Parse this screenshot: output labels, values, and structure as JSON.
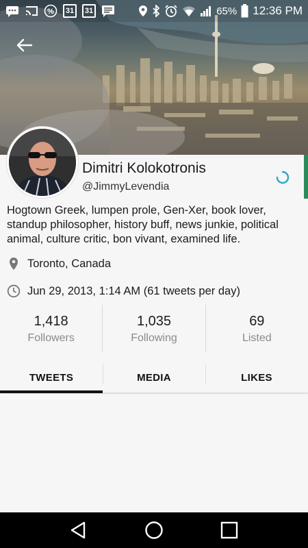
{
  "status_bar": {
    "calendar_day_1": "31",
    "calendar_day_2": "31",
    "battery": "65%",
    "time": "12:36 PM",
    "icons": [
      "message-icon",
      "cast-icon",
      "percent-icon",
      "calendar-icon",
      "calendar-icon",
      "chat-icon",
      "location-icon",
      "bluetooth-icon",
      "alarm-icon",
      "wifi-icon",
      "signal-icon",
      "battery-icon"
    ]
  },
  "profile": {
    "name": "Dimitri Kolokotronis",
    "handle": "@JimmyLevendia",
    "bio": "Hogtown Greek, lumpen prole, Gen-Xer, book lover, standup philosopher, history buff, news junkie, political animal, culture critic, bon vivant, examined life.",
    "location": "Toronto, Canada",
    "joined": "Jun 29, 2013, 1:14 AM (61 tweets per day)"
  },
  "stats": [
    {
      "count": "1,418",
      "label": "Followers"
    },
    {
      "count": "1,035",
      "label": "Following"
    },
    {
      "count": "69",
      "label": "Listed"
    }
  ],
  "tabs": [
    {
      "label": "TWEETS",
      "active": true
    },
    {
      "label": "MEDIA",
      "active": false
    },
    {
      "label": "LIKES",
      "active": false
    }
  ],
  "colors": {
    "accent_green": "#2a8a5a",
    "spinner": "#2aa7c9"
  }
}
